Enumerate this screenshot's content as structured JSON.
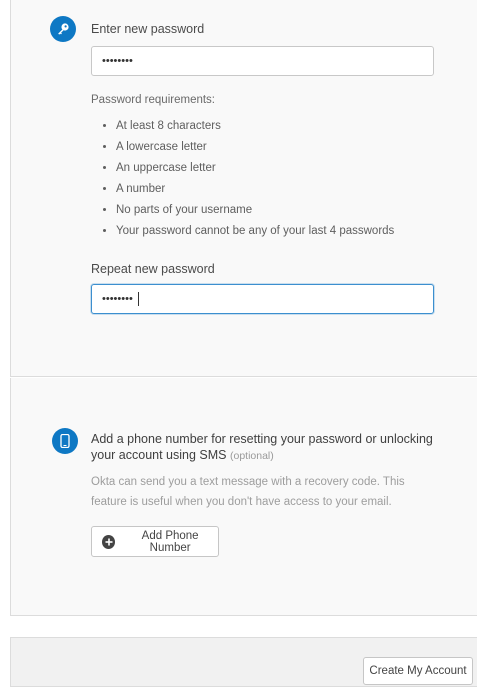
{
  "password_section": {
    "icon": "key-icon",
    "new_password_label": "Enter new password",
    "new_password_value": "••••••••",
    "requirements_title": "Password requirements:",
    "requirements": [
      "At least 8 characters",
      "A lowercase letter",
      "An uppercase letter",
      "A number",
      "No parts of your username",
      "Your password cannot be any of your last 4 passwords"
    ],
    "repeat_password_label": "Repeat new password",
    "repeat_password_value": "••••••••"
  },
  "phone_section": {
    "icon": "phone-icon",
    "title": "Add a phone number for resetting your password or unlocking your account using SMS",
    "optional_tag": "(optional)",
    "description": "Okta can send you a text message with a recovery code. This feature is useful when you don't have access to your email.",
    "add_button_label": "Add Phone Number"
  },
  "footer": {
    "create_button_label": "Create My Account"
  },
  "colors": {
    "accent": "#0e78c4",
    "focus_border": "#3c8fcf"
  }
}
